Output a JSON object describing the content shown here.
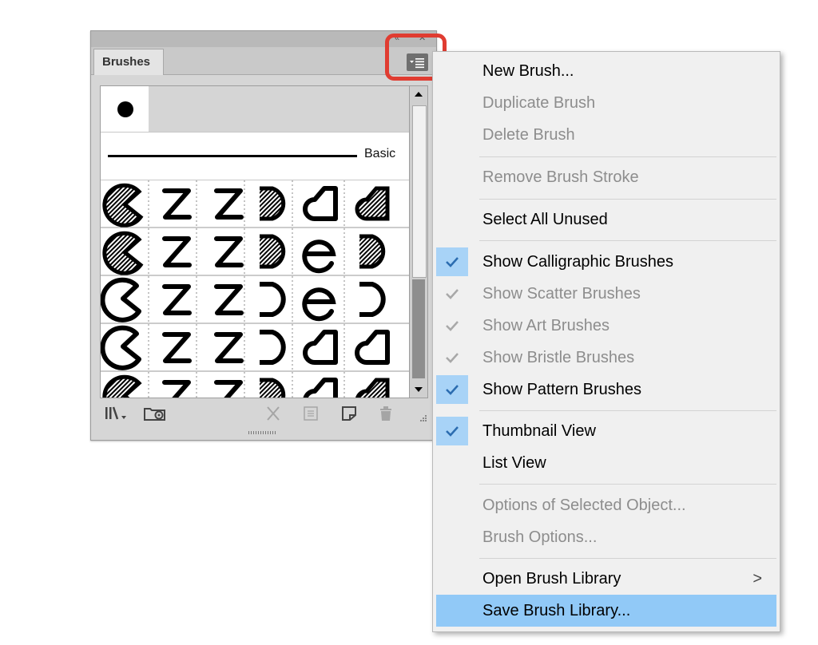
{
  "panel": {
    "tab_label": "Brushes",
    "titlebar_collapse": "«",
    "titlebar_close": "✕",
    "basic_brush_label": "Basic"
  },
  "menu": {
    "new_brush": "New Brush...",
    "duplicate_brush": "Duplicate Brush",
    "delete_brush": "Delete Brush",
    "remove_brush_stroke": "Remove Brush Stroke",
    "select_all_unused": "Select All Unused",
    "show_calligraphic": "Show Calligraphic Brushes",
    "show_scatter": "Show Scatter Brushes",
    "show_art": "Show Art Brushes",
    "show_bristle": "Show Bristle Brushes",
    "show_pattern": "Show Pattern Brushes",
    "thumbnail_view": "Thumbnail View",
    "list_view": "List View",
    "options_selected": "Options of Selected Object...",
    "brush_options": "Brush Options...",
    "open_library": "Open Brush Library",
    "save_library": "Save Brush Library...",
    "submenu_arrow": ">"
  },
  "colors": {
    "highlight_ring": "#e03c31",
    "menu_hover": "#91c9f7",
    "check_active_bg": "#a8d3f7",
    "check_active": "#2b6cb0"
  },
  "icons": [
    "brush-libraries-menu-icon",
    "libraries-panel-icon",
    "remove-brush-stroke-icon",
    "options-icon",
    "new-brush-icon",
    "delete-brush-icon",
    "panel-menu-icon",
    "checkmark-icon",
    "dot-brush-icon"
  ]
}
